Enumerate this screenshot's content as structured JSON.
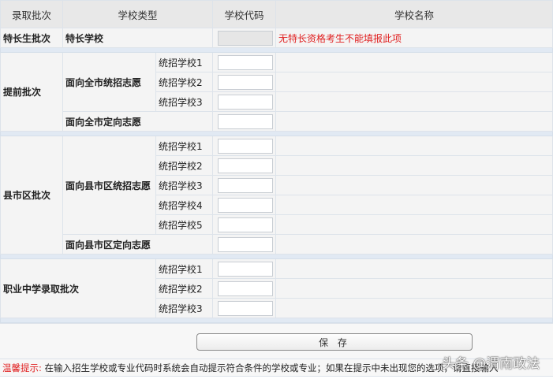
{
  "headers": [
    "录取批次",
    "学校类型",
    "学校代码",
    "学校名称"
  ],
  "special": {
    "batch": "特长生批次",
    "type": "特长学校",
    "note": "无特长资格考生不能填报此项"
  },
  "early": {
    "batch": "提前批次",
    "group1": "面向全市统招志愿",
    "items": [
      "统招学校1",
      "统招学校2",
      "统招学校3"
    ],
    "group2": "面向全市定向志愿"
  },
  "county": {
    "batch": "县市区批次",
    "group1": "面向县市区统招志愿",
    "items": [
      "统招学校1",
      "统招学校2",
      "统招学校3",
      "统招学校4",
      "统招学校5"
    ],
    "group2": "面向县市区定向志愿"
  },
  "vocational": {
    "batch": "职业中学录取批次",
    "items": [
      "统招学校1",
      "统招学校2",
      "统招学校3"
    ]
  },
  "save_label": "保 存",
  "tip": {
    "label": "温馨提示:",
    "text": "在输入招生学校或专业代码时系统会自动提示符合条件的学校或专业；如果在提示中未出现您的选项，请直接输入"
  },
  "watermark": "头条 @渭南政法"
}
